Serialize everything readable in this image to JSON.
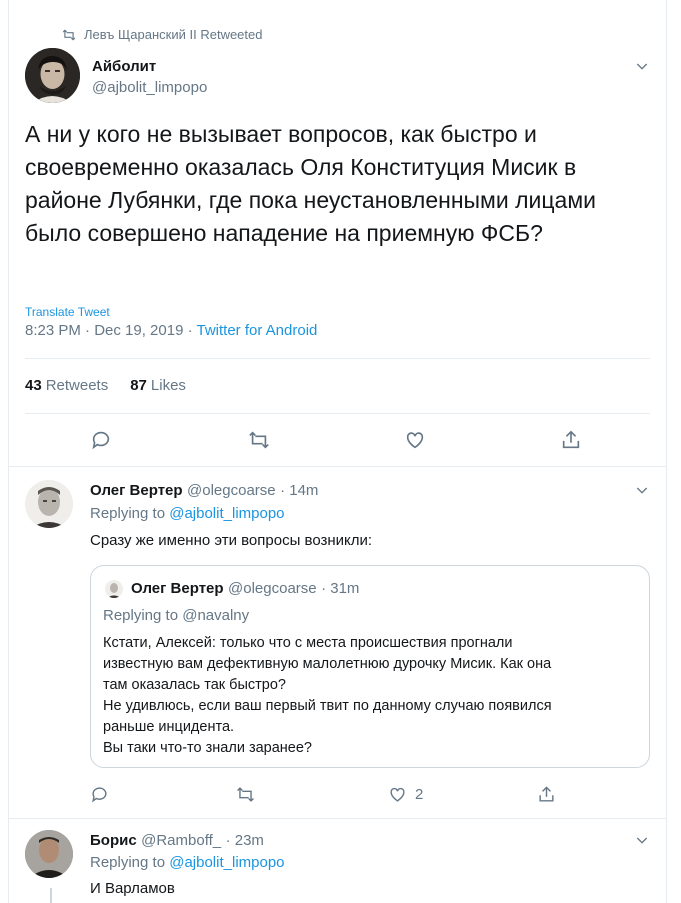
{
  "retweet_banner": {
    "text": "Левъ Щаранский II Retweeted",
    "icon": "retweet-icon"
  },
  "main_tweet": {
    "author_name": "Айболит",
    "author_handle": "@ajbolit_limpopo",
    "text": "А ни у кого не вызывает вопросов, как быстро и своевременно оказалась Оля Конституция Мисик в районе Лубянки, где пока неустановленными лицами было совершено нападение на приемную ФСБ?",
    "translate_label": "Translate Tweet",
    "time": "8:23 PM · Dec 19, 2019 · ",
    "source": "Twitter for Android",
    "retweets_count": "43",
    "retweets_label": "Retweets",
    "likes_count": "87",
    "likes_label": "Likes"
  },
  "replies": [
    {
      "author_name": "Олег Вертер",
      "author_handle": "@olegcoarse",
      "time": "· 14m",
      "replying_prefix": "Replying to ",
      "replying_to": "@ajbolit_limpopo",
      "text": "Сразу же именно эти вопросы возникли:",
      "quote": {
        "author_name": "Олег Вертер",
        "author_handle": "@olegcoarse",
        "time": "· 31m",
        "replying_prefix": "Replying to ",
        "replying_to": "@navalny",
        "lines": [
          "Кстати, Алексей: только что с места происшествия прогнали",
          "известную вам дефективную малолетнюю дурочку Мисик. Как она",
          "там оказалась так быстро?",
          "Не удивлюсь, если ваш первый твит по данному случаю появился",
          "раньше инцидента.",
          "Вы таки что-то знали заранее?"
        ]
      },
      "like_count": "2"
    },
    {
      "author_name": "Борис",
      "author_handle": "@Ramboff_",
      "time": "· 23m",
      "replying_prefix": "Replying to ",
      "replying_to": "@ajbolit_limpopo",
      "text": "И Варламов"
    }
  ],
  "colors": {
    "accent": "#1b95e0",
    "muted": "#657786",
    "border": "#e6ecf0"
  }
}
